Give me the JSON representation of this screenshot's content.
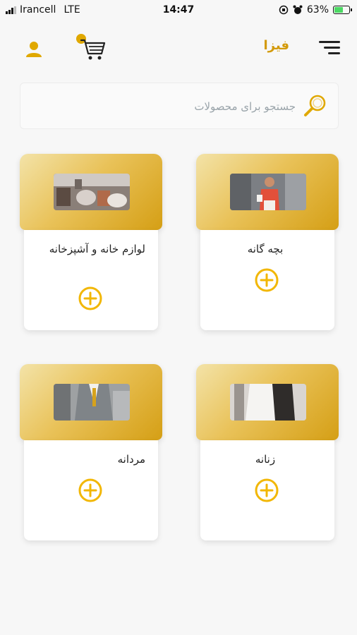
{
  "status_bar": {
    "carrier": "Irancell",
    "network": "LTE",
    "time": "14:47",
    "battery": "63%",
    "battery_level": 0.63
  },
  "header": {
    "brand": "فیزا",
    "cart_count": "",
    "icons": {
      "user": "user-icon",
      "cart": "cart-icon",
      "menu": "menu-icon"
    }
  },
  "search": {
    "placeholder": "جستجو برای محصولات",
    "value": ""
  },
  "categories": [
    {
      "title": "لوازم خانه و آشپزخانه"
    },
    {
      "title": "بچه گانه"
    },
    {
      "title": "مردانه"
    },
    {
      "title": "زنانه"
    }
  ],
  "colors": {
    "accent": "#e0a800",
    "brand": "#d39a0a",
    "gold_light": "#f3e3a8",
    "gold_dark": "#d59f15"
  }
}
